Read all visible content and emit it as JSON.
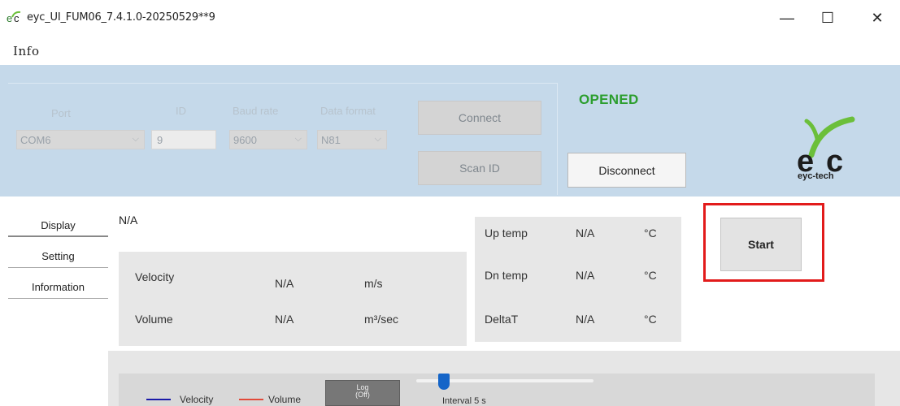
{
  "window": {
    "title": "eyc_UI_FUM06_7.4.1.0-20250529**9",
    "minimize_glyph": "—",
    "maximize_glyph": "☐",
    "close_glyph": "✕"
  },
  "menu": {
    "info": "Info"
  },
  "connection": {
    "port_label": "Port",
    "port_value": "COM6",
    "id_label": "ID",
    "id_value": "9",
    "baud_label": "Baud rate",
    "baud_value": "9600",
    "format_label": "Data format",
    "format_value": "N81",
    "connect_label": "Connect",
    "scan_label": "Scan ID",
    "status": "OPENED",
    "disconnect_label": "Disconnect",
    "logo_text": "eyc-tech",
    "colors": {
      "panel_bg": "#c5d9ea",
      "status_green": "#2c9e2e"
    }
  },
  "nav": {
    "items": [
      {
        "label": "Display"
      },
      {
        "label": "Setting"
      },
      {
        "label": "Information"
      }
    ]
  },
  "display": {
    "status_na": "N/A",
    "velocity_label": "Velocity",
    "velocity_value": "N/A",
    "velocity_unit": "m/s",
    "volume_label": "Volume",
    "volume_value": "N/A",
    "volume_unit": "m³/sec",
    "temps": [
      {
        "label": "Up temp",
        "value": "N/A",
        "unit": "°C"
      },
      {
        "label": "Dn temp",
        "value": "N/A",
        "unit": "°C"
      },
      {
        "label": "DeltaT",
        "value": "N/A",
        "unit": "°C"
      }
    ],
    "start_label": "Start",
    "highlight_color": "#e21b1b"
  },
  "chart": {
    "legend_velocity": "Velocity",
    "legend_velocity_color": "#1a1aa8",
    "legend_volume": "Volume",
    "legend_volume_color": "#e24a3a",
    "log_label_1": "Log",
    "log_label_2": "(Off)",
    "interval_label": "Interval 5 s"
  }
}
